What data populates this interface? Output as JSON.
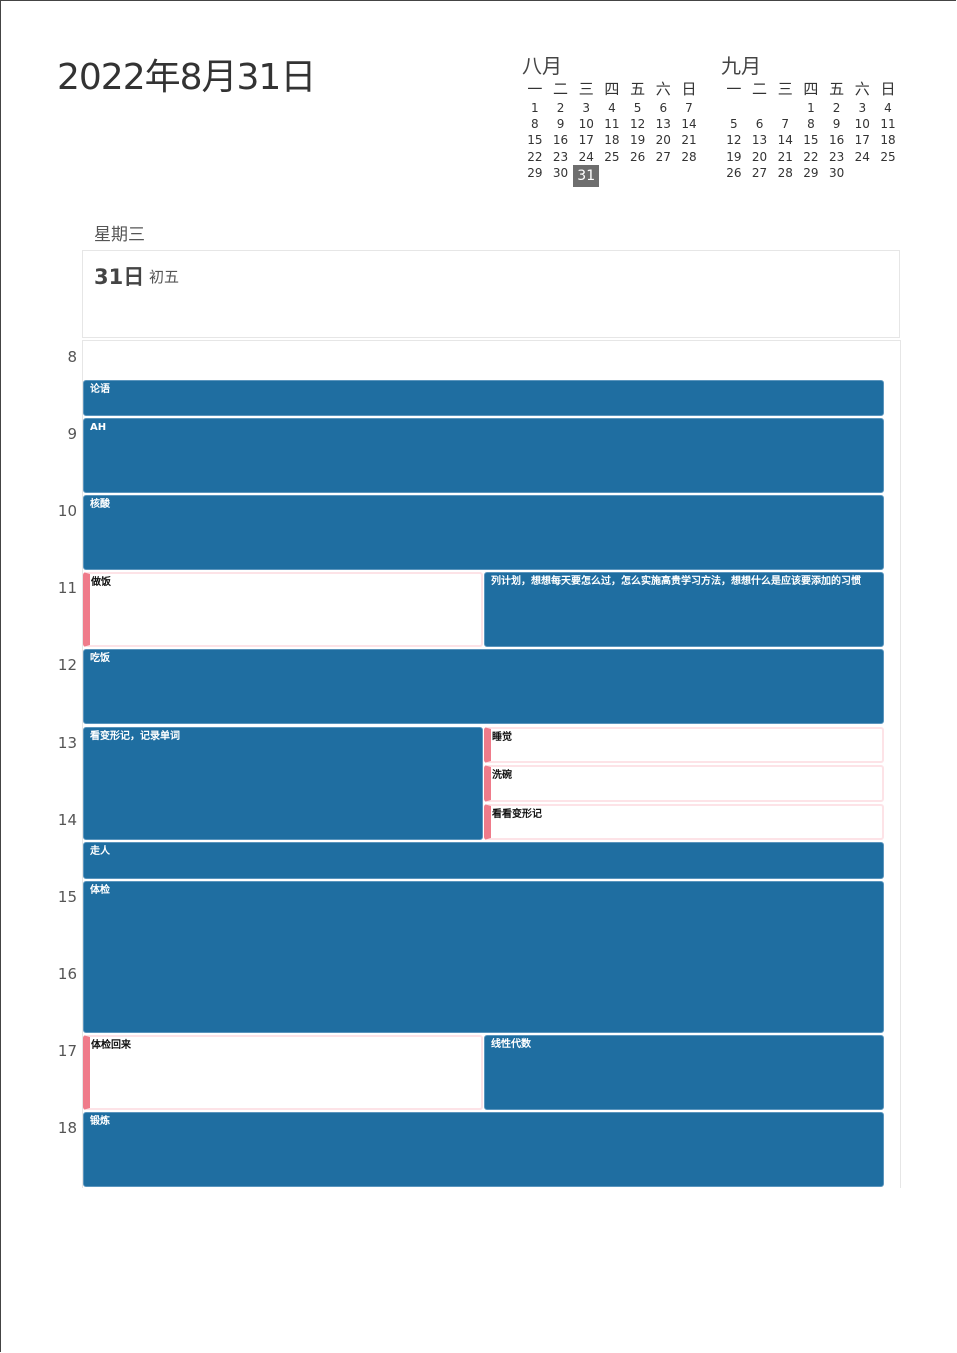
{
  "header": {
    "date_title": "2022年8月31日"
  },
  "mini_calendars": [
    {
      "title": "八月",
      "weekdays": [
        "一",
        "二",
        "三",
        "四",
        "五",
        "六",
        "日"
      ],
      "weeks": [
        [
          "1",
          "2",
          "3",
          "4",
          "5",
          "6",
          "7"
        ],
        [
          "8",
          "9",
          "10",
          "11",
          "12",
          "13",
          "14"
        ],
        [
          "15",
          "16",
          "17",
          "18",
          "19",
          "20",
          "21"
        ],
        [
          "22",
          "23",
          "24",
          "25",
          "26",
          "27",
          "28"
        ],
        [
          "29",
          "30",
          "31",
          "",
          "",
          "",
          ""
        ]
      ],
      "selected": "31"
    },
    {
      "title": "九月",
      "weekdays": [
        "一",
        "二",
        "三",
        "四",
        "五",
        "六",
        "日"
      ],
      "weeks": [
        [
          "",
          "",
          "",
          "1",
          "2",
          "3",
          "4"
        ],
        [
          "5",
          "6",
          "7",
          "8",
          "9",
          "10",
          "11"
        ],
        [
          "12",
          "13",
          "14",
          "15",
          "16",
          "17",
          "18"
        ],
        [
          "19",
          "20",
          "21",
          "22",
          "23",
          "24",
          "25"
        ],
        [
          "26",
          "27",
          "28",
          "29",
          "30",
          "",
          ""
        ]
      ],
      "selected": ""
    }
  ],
  "day": {
    "weekday": "星期三",
    "day_number": "31日",
    "lunar": "初五"
  },
  "hours": [
    "8",
    "9",
    "10",
    "11",
    "12",
    "13",
    "14",
    "15",
    "16",
    "17",
    "18"
  ],
  "events": [
    {
      "title": "论语",
      "style": "blue",
      "start": 8.5,
      "end": 9.0,
      "col": 0,
      "cols": 1
    },
    {
      "title": "AH",
      "style": "blue",
      "start": 9.0,
      "end": 10.0,
      "col": 0,
      "cols": 1
    },
    {
      "title": "核酸",
      "style": "blue",
      "start": 10.0,
      "end": 11.0,
      "col": 0,
      "cols": 1
    },
    {
      "title": "做饭",
      "style": "white",
      "start": 11.0,
      "end": 12.0,
      "col": 0,
      "cols": 2
    },
    {
      "title": "列计划，想想每天要怎么过，怎么实施高贵学习方法，想想什么是应该要添加的习惯",
      "style": "blue",
      "start": 11.0,
      "end": 12.0,
      "col": 1,
      "cols": 2
    },
    {
      "title": "吃饭",
      "style": "blue",
      "start": 12.0,
      "end": 13.0,
      "col": 0,
      "cols": 1
    },
    {
      "title": "看变形记，记录单词",
      "style": "blue",
      "start": 13.0,
      "end": 14.5,
      "col": 0,
      "cols": 2
    },
    {
      "title": "睡觉",
      "style": "white",
      "start": 13.0,
      "end": 13.5,
      "col": 1,
      "cols": 2
    },
    {
      "title": "洗碗",
      "style": "white",
      "start": 13.5,
      "end": 14.0,
      "col": 1,
      "cols": 2
    },
    {
      "title": "看看变形记",
      "style": "white",
      "start": 14.0,
      "end": 14.5,
      "col": 1,
      "cols": 2
    },
    {
      "title": "走人",
      "style": "blue",
      "start": 14.5,
      "end": 15.0,
      "col": 0,
      "cols": 1
    },
    {
      "title": "体检",
      "style": "blue",
      "start": 15.0,
      "end": 17.0,
      "col": 0,
      "cols": 1
    },
    {
      "title": "体检回来",
      "style": "white",
      "start": 17.0,
      "end": 18.0,
      "col": 0,
      "cols": 2
    },
    {
      "title": "线性代数",
      "style": "blue",
      "start": 17.0,
      "end": 18.0,
      "col": 1,
      "cols": 2
    },
    {
      "title": "锻炼",
      "style": "blue",
      "start": 18.0,
      "end": 19.0,
      "col": 0,
      "cols": 1
    }
  ]
}
